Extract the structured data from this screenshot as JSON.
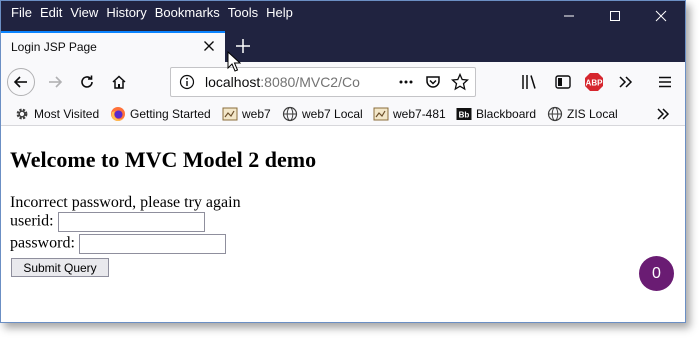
{
  "menu": [
    "File",
    "Edit",
    "View",
    "History",
    "Bookmarks",
    "Tools",
    "Help"
  ],
  "tab": {
    "title": "Login JSP Page"
  },
  "urlbar": {
    "host": "localhost",
    "rest": ":8080/MVC2/Co"
  },
  "bookmarks": [
    {
      "label": "Most Visited",
      "icon": "gear-icon"
    },
    {
      "label": "Getting Started",
      "icon": "firefox-icon"
    },
    {
      "label": "web7",
      "icon": "page-icon"
    },
    {
      "label": "web7 Local",
      "icon": "globe-icon"
    },
    {
      "label": "web7-481",
      "icon": "page-icon"
    },
    {
      "label": "Blackboard",
      "icon": "blackboard-icon"
    },
    {
      "label": "ZIS Local",
      "icon": "globe-icon"
    }
  ],
  "page": {
    "heading": "Welcome to MVC Model 2 demo",
    "message": "Incorrect password, please try again",
    "userid_label": "userid:",
    "userid_value": "",
    "password_label": "password:",
    "password_value": "",
    "submit_label": "Submit Query"
  },
  "notification_count": "0",
  "colors": {
    "titlebar": "#202340",
    "tab_accent": "#0a84ff",
    "bubble": "#6a1c73",
    "abp": "#d6262e"
  }
}
